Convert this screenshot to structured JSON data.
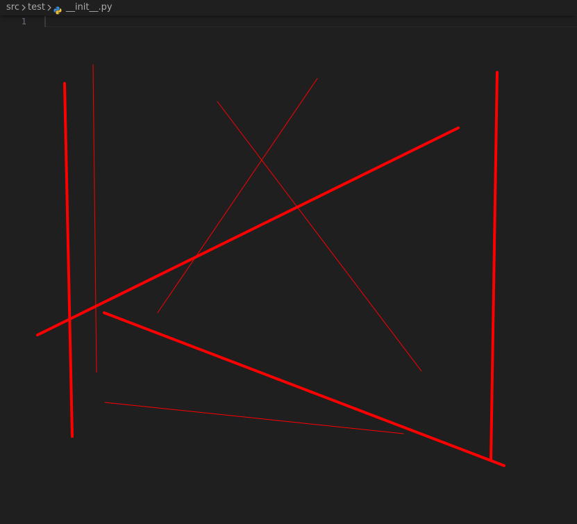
{
  "breadcrumb": {
    "items": [
      {
        "label": "src"
      },
      {
        "label": "test"
      },
      {
        "label": "__init__.py",
        "icon": "python-icon"
      }
    ]
  },
  "editor": {
    "line_number": "1",
    "line_text": ""
  },
  "colors": {
    "background": "#1f1f1f",
    "annotation": "#ff0000",
    "breadcrumb_text": "#a9a9a9",
    "line_number": "#6e7681",
    "python_blue": "#3b8ed8",
    "python_yellow": "#f0c53a"
  }
}
